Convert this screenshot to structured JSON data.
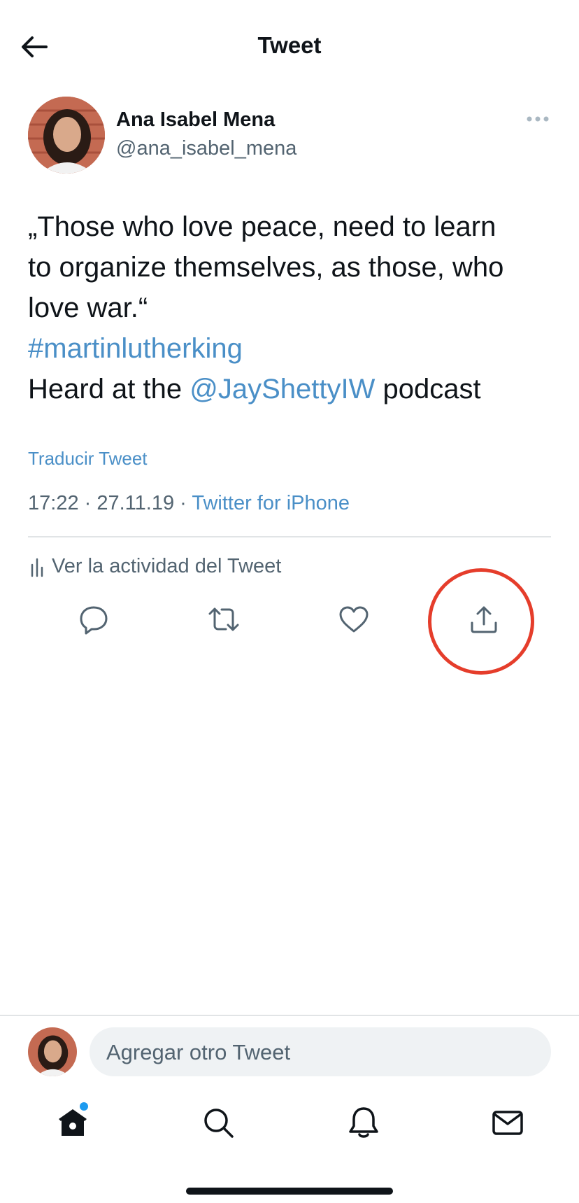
{
  "header": {
    "title": "Tweet"
  },
  "author": {
    "name": "Ana Isabel Mena",
    "handle": "@ana_isabel_mena"
  },
  "tweet": {
    "text_line1": "„Those who love peace, need to learn",
    "text_line2": "to organize themselves, as those, who",
    "text_line3": "love war.“",
    "hashtag": "#martinlutherking",
    "line5_prefix": "Heard at the ",
    "mention": "@JayShettyIW",
    "line5_suffix": " podcast",
    "translate_label": "Traducir Tweet",
    "time": "17:22",
    "date": "27.11.19",
    "separator": " · ",
    "source": "Twitter for iPhone"
  },
  "activity": {
    "label": "Ver la actividad del Tweet"
  },
  "actions": [
    "reply-icon",
    "retweet-icon",
    "like-icon",
    "share-icon"
  ],
  "compose": {
    "placeholder": "Agregar otro Tweet"
  },
  "nav": [
    "home-icon",
    "search-icon",
    "notifications-icon",
    "messages-icon"
  ],
  "colors": {
    "link": "#4a8fc7",
    "highlight": "#e53d2b",
    "muted": "#536471"
  }
}
